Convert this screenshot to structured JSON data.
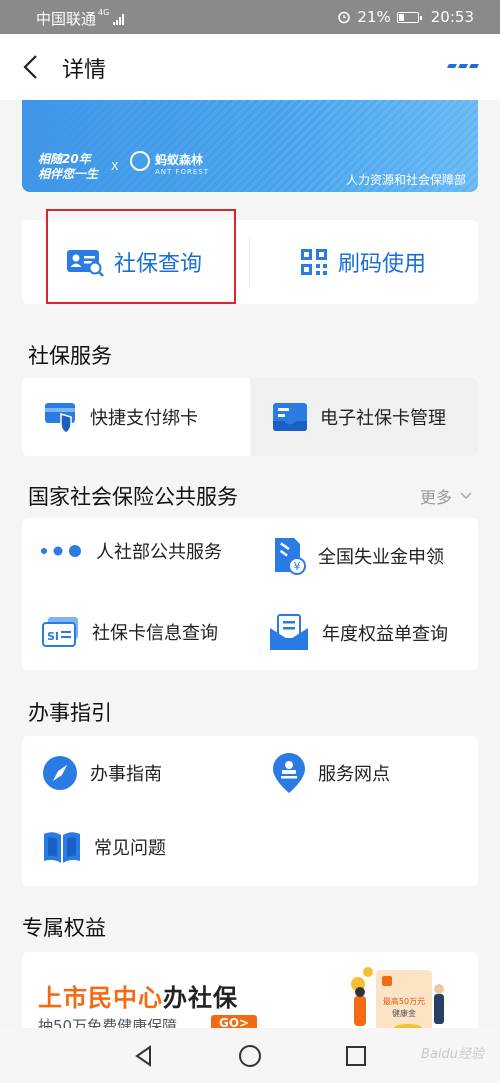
{
  "status_bar": {
    "carrier": "中国联通",
    "network": "4G",
    "battery": "21%",
    "time": "20:53"
  },
  "header": {
    "title": "详情"
  },
  "banner": {
    "slogan_line1": "相随20年",
    "slogan_line2": "相伴您一生",
    "separator": "X",
    "partner_name": "蚂蚁森林",
    "partner_en": "ANT FOREST",
    "org": "人力资源和社会保障部"
  },
  "quick_actions": [
    {
      "label": "社保查询",
      "icon": "id-card-search-icon"
    },
    {
      "label": "刷码使用",
      "icon": "qr-code-icon"
    }
  ],
  "social_security_services": {
    "title": "社保服务",
    "items": [
      {
        "label": "快捷支付绑卡",
        "icon": "card-shield-icon"
      },
      {
        "label": "电子社保卡管理",
        "icon": "e-card-icon"
      }
    ]
  },
  "national_services": {
    "title": "国家社会保险公共服务",
    "more_label": "更多",
    "items": [
      {
        "label": "人社部公共服务",
        "icon": "dots-icon"
      },
      {
        "label": "全国失业金申领",
        "icon": "unemployment-yuan-icon"
      },
      {
        "label": "社保卡信息查询",
        "icon": "si-card-icon"
      },
      {
        "label": "年度权益单查询",
        "icon": "statement-icon"
      }
    ]
  },
  "guide": {
    "title": "办事指引",
    "items": [
      {
        "label": "办事指南",
        "icon": "compass-icon"
      },
      {
        "label": "服务网点",
        "icon": "location-pin-icon"
      },
      {
        "label": "常见问题",
        "icon": "open-book-icon"
      }
    ]
  },
  "exclusive": {
    "title": "专属权益",
    "ad_title_orange": "上市民中心",
    "ad_title_black": "办社保",
    "ad_subtitle": "抽50万免费健康保障",
    "ad_button": "GO>",
    "ad_badge_line1": "最高50万元",
    "ad_badge_line2": "健康金"
  },
  "nav_bar": {
    "watermark": "Baidu经验"
  },
  "colors": {
    "primary_blue": "#1a6fd6",
    "icon_blue": "#2b7be4",
    "promo_orange": "#f26a11",
    "highlight_red": "#d9262c"
  }
}
